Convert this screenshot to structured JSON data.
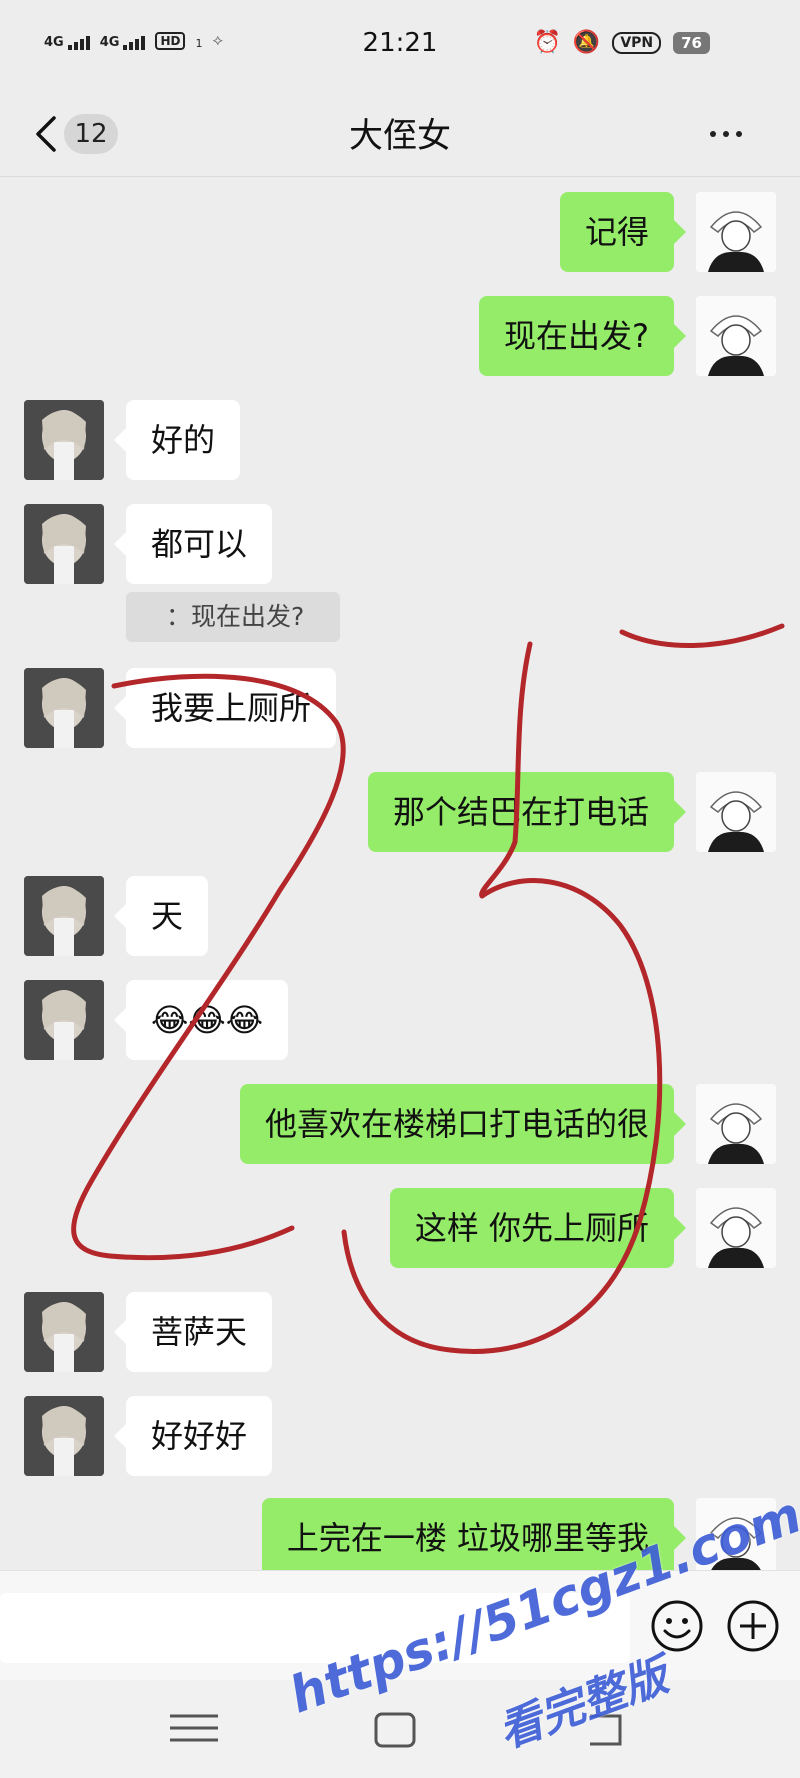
{
  "status_bar": {
    "network_1": "4G",
    "network_2": "4G",
    "hd_label": "HD",
    "hd_sub": "1",
    "time": "21:21",
    "vpn_label": "VPN",
    "battery": "76"
  },
  "header": {
    "unread_count": "12",
    "title": "大侄女"
  },
  "messages": [
    {
      "from": "me",
      "text": "记得"
    },
    {
      "from": "me",
      "text": "现在出发?"
    },
    {
      "from": "other",
      "text": "好的"
    },
    {
      "from": "other",
      "text": "都可以"
    },
    {
      "from": "other",
      "text": "我要上厕所"
    },
    {
      "from": "me",
      "text": "那个结巴在打电话"
    },
    {
      "from": "other",
      "text": "天"
    },
    {
      "from": "other",
      "text": "😂😂😂"
    },
    {
      "from": "me",
      "text": "他喜欢在楼梯口打电话的很"
    },
    {
      "from": "me",
      "text": "这样 你先上厕所"
    },
    {
      "from": "other",
      "text": "菩萨天"
    },
    {
      "from": "other",
      "text": "好好好"
    },
    {
      "from": "me",
      "text": "上完在一楼 垃圾哪里等我"
    }
  ],
  "quote": {
    "text": "：现在出发?"
  },
  "input": {
    "placeholder": ""
  },
  "watermark": {
    "line1": "https://51cgz1.com",
    "line2": "看完整版"
  },
  "colors": {
    "my_bubble": "#95ec69",
    "other_bubble": "#ffffff",
    "background": "#ededed",
    "scribble": "#b3262a",
    "watermark": "#3f5fd6"
  },
  "icons": [
    "back-icon",
    "more-icon",
    "alarm-icon",
    "mute-icon",
    "emoji-icon",
    "plus-icon",
    "menu-icon",
    "home-icon",
    "nav-back-icon"
  ]
}
